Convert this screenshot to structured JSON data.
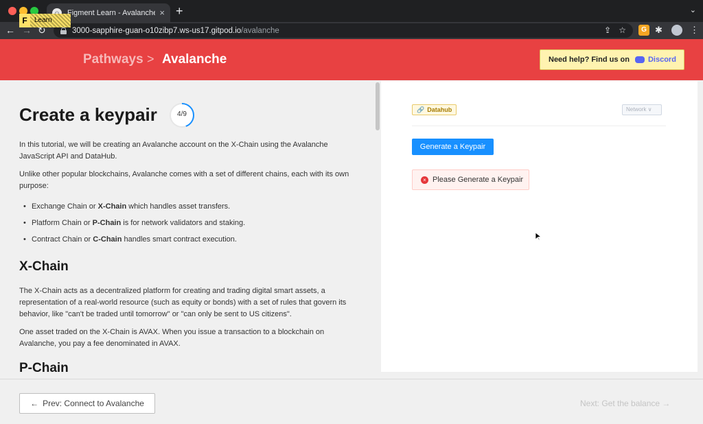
{
  "browser": {
    "tab_title": "Figment Learn - Avalanche Pat",
    "tab_close": "×",
    "new_tab": "+",
    "url_host": "3000-sapphire-guan-o10zibp7.ws-us17.gitpod.io",
    "url_path": "/avalanche"
  },
  "header": {
    "logo_letter": "F",
    "logo_text": "Learn",
    "breadcrumb_parent": "Pathways",
    "breadcrumb_separator": ">",
    "breadcrumb_current": "Avalanche",
    "help_text": "Need help? Find us on",
    "discord_label": "Discord",
    "brand_color": "#e84142"
  },
  "content": {
    "title": "Create a keypair",
    "progress": "4/9",
    "progress_fraction": 0.444,
    "intro": "In this tutorial, we will be creating an Avalanche account on the X-Chain using the Avalanche JavaScript API and DataHub.",
    "chains_intro": "Unlike other popular blockchains, Avalanche comes with a set of different chains, each with its own purpose:",
    "bullets": [
      {
        "before": "Exchange Chain or ",
        "bold": "X-Chain",
        "after": " which handles asset transfers."
      },
      {
        "before": "Platform Chain or ",
        "bold": "P-Chain",
        "after": " is for network validators and staking."
      },
      {
        "before": "Contract Chain or ",
        "bold": "C-Chain",
        "after": " handles smart contract execution."
      }
    ],
    "xchain_heading": "X-Chain",
    "xchain_para1": "The X-Chain acts as a decentralized platform for creating and trading digital smart assets, a representation of a real-world resource (such as equity or bonds) with a set of rules that govern its behavior, like \"can't be traded until tomorrow\" or \"can only be sent to US citizens\".",
    "xchain_para2": "One asset traded on the X-Chain is AVAX. When you issue a transaction to a blockchain on Avalanche, you pay a fee denominated in AVAX.",
    "pchain_heading": "P-Chain"
  },
  "panel": {
    "datahub_tag": "Datahub",
    "network_select": "Network ∨",
    "generate_button": "Generate a Keypair",
    "alert_text": "Please Generate a Keypair",
    "alert_icon": "×"
  },
  "footer": {
    "prev_label": "Prev: Connect to Avalanche",
    "next_label": "Next: Get the balance →"
  }
}
